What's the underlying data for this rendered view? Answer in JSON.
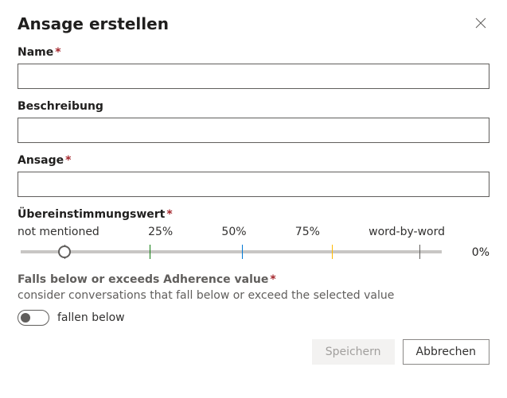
{
  "dialog": {
    "title": "Ansage erstellen"
  },
  "fields": {
    "name": {
      "label": "Name",
      "required": true,
      "value": ""
    },
    "description": {
      "label": "Beschreibung",
      "required": false,
      "value": ""
    },
    "announcement": {
      "label": "Ansage",
      "required": true,
      "value": ""
    }
  },
  "slider": {
    "label": "Übereinstimmungswert",
    "required": true,
    "ticks": {
      "min": "not mentioned",
      "p25": "25%",
      "p50": "50%",
      "p75": "75%",
      "max": "word-by-word"
    },
    "value_display": "0%"
  },
  "adherence": {
    "title": "Falls below or exceeds Adherence value",
    "required": true,
    "helper": "consider conversations that fall below or exceed the selected value",
    "toggle_label": "fallen below",
    "toggle_on": false
  },
  "footer": {
    "save": "Speichern",
    "cancel": "Abbrechen"
  }
}
